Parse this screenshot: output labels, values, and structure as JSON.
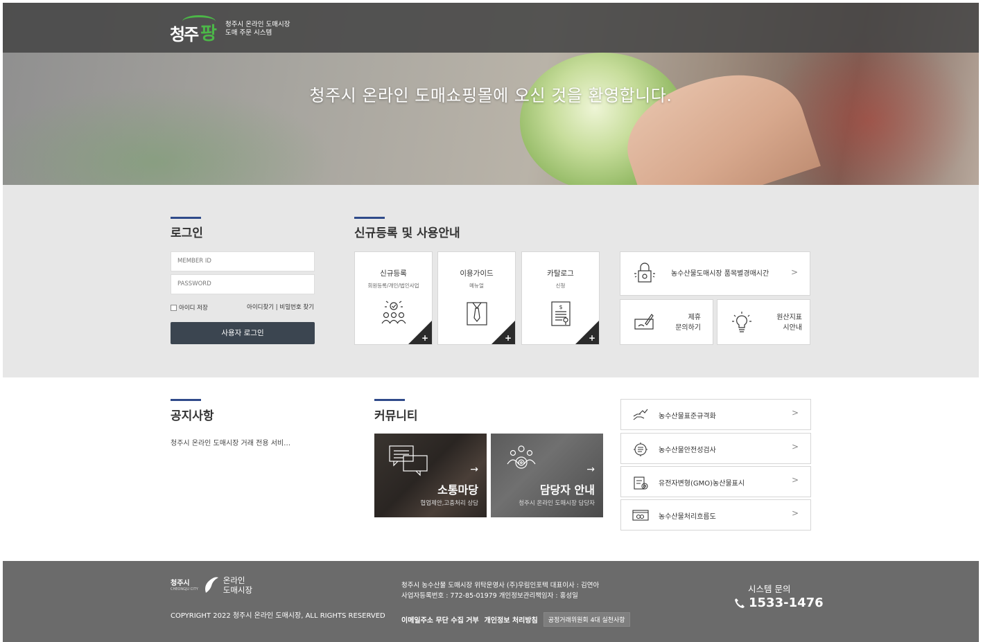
{
  "header": {
    "logo_main": "청주",
    "logo_accent": "팡",
    "logo_line1": "청주시 온라인 도매시장",
    "logo_line2": "도매 주문 시스템"
  },
  "hero": {
    "welcome": "청주시 온라인 도매쇼핑몰에 오신 것을 환영합니다."
  },
  "login": {
    "title": "로그인",
    "id_placeholder": "MEMBER ID",
    "pw_placeholder": "PASSWORD",
    "save_id_label": "아이디 저장",
    "find_link": "아이디찾기 | 비밀번호 찾기",
    "button_label": "사용자 로그인"
  },
  "signup": {
    "title": "신규등록 및 사용안내",
    "cards": [
      {
        "title": "신규등록",
        "subtitle": "회원등록/개인/법인사업",
        "icon": "people-check-icon"
      },
      {
        "title": "이용가이드",
        "subtitle": "메뉴얼",
        "icon": "shirt-tie-icon"
      },
      {
        "title": "카탈로그",
        "subtitle": "신청",
        "icon": "document-dollar-icon"
      }
    ],
    "quick": {
      "auction_time": "농수산물도매시장 품목별경매시간",
      "partnership_line1": "제휴",
      "partnership_line2": "문의하기",
      "origin_line1": "원산지표",
      "origin_line2": "시안내"
    }
  },
  "notice": {
    "title": "공지사항",
    "items": [
      "청주시 온라인 도매시장 거래 전용 서비…"
    ]
  },
  "community": {
    "title": "커뮤니티",
    "cards": [
      {
        "title": "소통마당",
        "subtitle": "협업제안,고충처리 상담"
      },
      {
        "title": "담당자 안내",
        "subtitle": "청주시 온라인 도매시장 담당자"
      }
    ]
  },
  "info_links": [
    {
      "label": "농수산물표준규격화",
      "icon": "hand-chart-icon"
    },
    {
      "label": "농수산물안전성검사",
      "icon": "gear-list-icon"
    },
    {
      "label": "유전자변형(GMO)농산물표시",
      "icon": "clipboard-gmo-icon"
    },
    {
      "label": "농수산물처리흐름도",
      "icon": "flow-link-icon"
    }
  ],
  "footer": {
    "logo_city": "청주시",
    "logo_city_en": "CHEONGJU CITY",
    "logo_name_line1": "온라인",
    "logo_name_line2": "도매시장",
    "copyright": "COPYRIGHT 2022 청주시 온라인 도매시장, ALL RIGHTS RESERVED",
    "info_line1": "청주시 농수산물 도매시장 위탁운영사 (주)우림인포텍 대표이사 : 김연아",
    "info_line2": "사업자등록번호 : 772-85-01979 개인정보관리책임자 : 홍성일",
    "link_email": "이메일주소 무단 수집 거부",
    "link_privacy": "개인정보 처리방침",
    "link_fair": "공정거래위원회 4대 실천사항",
    "contact_title": "시스템 문의",
    "phone": "1533-1476"
  }
}
